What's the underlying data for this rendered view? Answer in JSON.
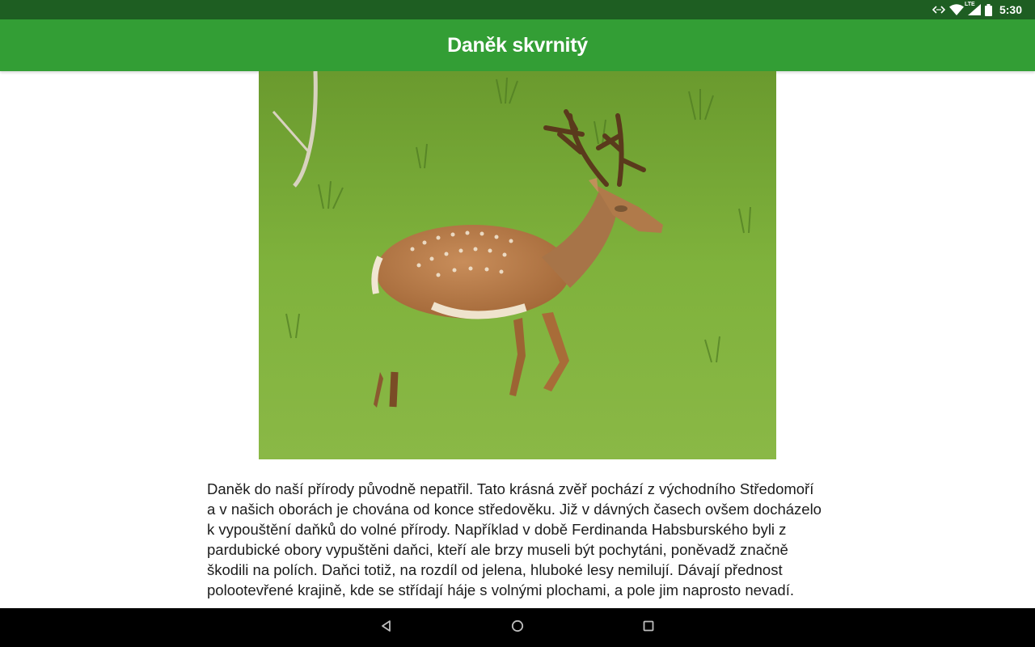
{
  "status_bar": {
    "time": "5:30",
    "network_label": "LTE",
    "icons": [
      "data-sync-icon",
      "wifi-icon",
      "cell-signal-icon",
      "battery-icon"
    ]
  },
  "app_bar": {
    "title": "Daněk skvrnitý",
    "background_color": "#339e35"
  },
  "main": {
    "image": {
      "subject": "fallow-deer-photo"
    },
    "article": {
      "text": "Daněk do naší přírody původně nepatřil. Tato krásná zvěř pochází z východního Středomoří a v našich oborách je chována od konce středověku. Již v dávných časech ovšem docházelo k vypouštění daňků do volné přírody. Například v době Ferdinanda Habsburského byli z pardubické obory vypuštěni daňci, kteří ale brzy museli být pochytáni, poněvadž značně škodili na polích. Daňci totiž, na rozdíl od jelena, hluboké lesy nemilují. Dávají přednost polootevřené krajině, kde se střídají háje s volnými plochami, a pole jim naprosto nevadí."
    }
  },
  "nav_bar": {
    "buttons": [
      "back-icon",
      "home-icon",
      "recents-icon"
    ]
  }
}
